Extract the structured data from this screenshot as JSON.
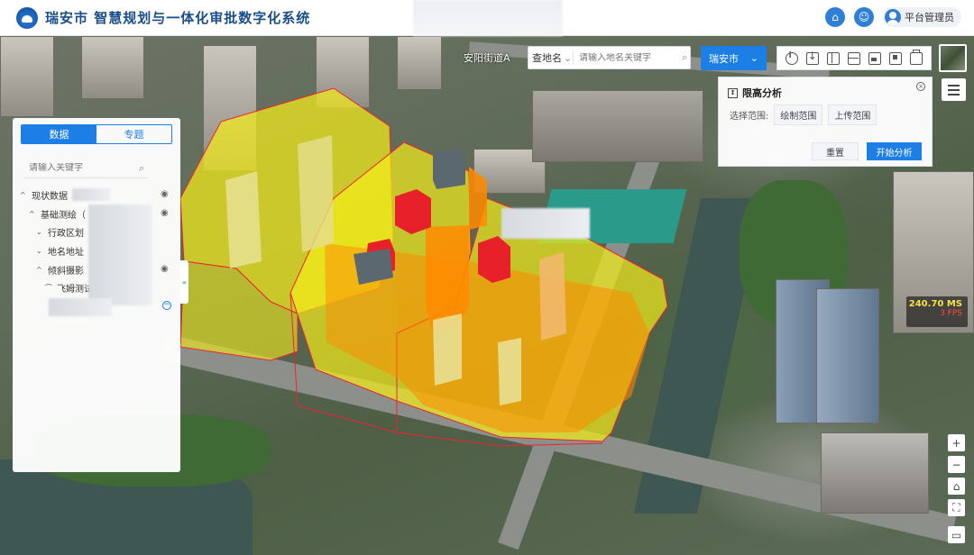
{
  "app": {
    "title": "瑞安市 智慧规划与一体化审批数字化系统"
  },
  "header": {
    "user_name": "平台管理员",
    "icons": [
      "home-icon",
      "user-group-icon",
      "avatar-icon"
    ]
  },
  "map": {
    "label": "安阳街道A"
  },
  "search": {
    "select_label": "查地名",
    "placeholder": "请输入地名关键字"
  },
  "city_selector": {
    "label": "瑞安市"
  },
  "toolbar": {
    "icons": [
      "info-icon",
      "download-icon",
      "split-icon",
      "grid-icon",
      "image-icon",
      "flag-icon",
      "box-icon"
    ]
  },
  "analysis": {
    "title": "限高分析",
    "range_label": "选择范围:",
    "draw_range": "绘制范围",
    "upload_range": "上传范围",
    "reset": "重置",
    "start": "开始分析"
  },
  "left_panel": {
    "tabs": [
      {
        "label": "数据",
        "active": true
      },
      {
        "label": "专题",
        "active": false
      }
    ],
    "search_placeholder": "请输入关键字",
    "tree": [
      {
        "label": "现状数据"
      },
      {
        "label": "基础测绘（"
      },
      {
        "label": "行政区划"
      },
      {
        "label": "地名地址"
      },
      {
        "label": "倾斜摄影"
      },
      {
        "label": "飞姆测试"
      }
    ]
  },
  "fps": {
    "ms": "240.70 MS",
    "fps": "3 FPS"
  },
  "colors": {
    "accent": "#1d7ee6",
    "highlight_zone": "#f4ec1a",
    "over_limit": "#ff8a00",
    "violation": "#e8202a"
  }
}
